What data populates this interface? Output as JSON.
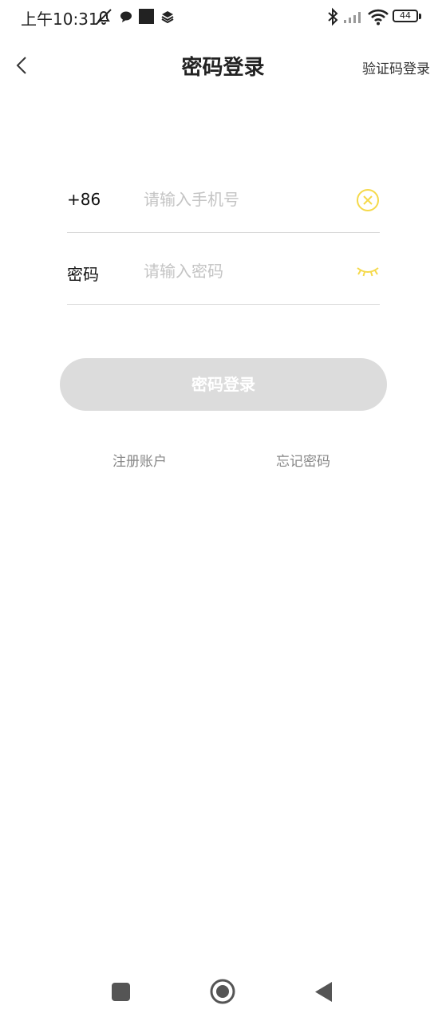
{
  "status_bar": {
    "time": "上午10:31",
    "battery": "44",
    "icons": [
      "mute-notification-icon",
      "chat-bubble-icon",
      "square-app-icon",
      "layers-icon",
      "bluetooth-icon",
      "signal-icon",
      "wifi-icon",
      "battery-icon"
    ]
  },
  "header": {
    "title": "密码登录",
    "switch_link": "验证码登录",
    "back_icon": "chevron-left-icon"
  },
  "form": {
    "phone": {
      "prefix": "+86",
      "placeholder": "请输入手机号",
      "value": "",
      "clear_icon": "clear-circle-icon"
    },
    "password": {
      "label": "密码",
      "placeholder": "请输入密码",
      "value": "",
      "toggle_icon": "eye-closed-icon"
    },
    "submit_label": "密码登录"
  },
  "links": {
    "register": "注册账户",
    "forgot": "忘记密码"
  },
  "nav_bar": {
    "icons": [
      "recent-apps-icon",
      "home-icon",
      "back-triangle-icon"
    ]
  },
  "colors": {
    "accent": "#f5d94a",
    "button_disabled": "#dcdcdc",
    "divider": "#d9d9d9",
    "placeholder": "#c4c4c4",
    "link": "#888888"
  }
}
